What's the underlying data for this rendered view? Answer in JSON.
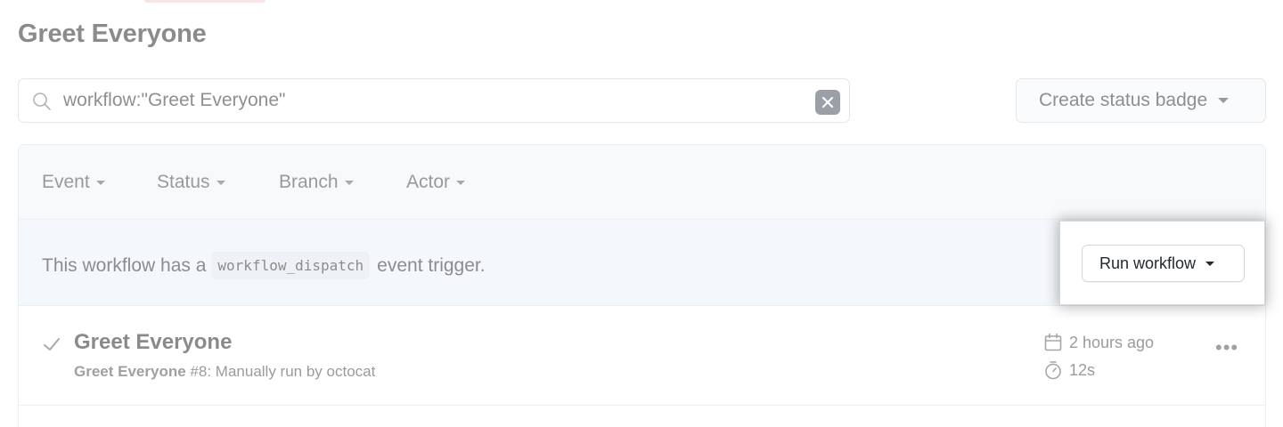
{
  "page": {
    "title": "Greet Everyone"
  },
  "search": {
    "query": "workflow:\"Greet Everyone\""
  },
  "actions": {
    "status_badge_label": "Create status badge"
  },
  "filters": [
    {
      "label": "Event"
    },
    {
      "label": "Status"
    },
    {
      "label": "Branch"
    },
    {
      "label": "Actor"
    }
  ],
  "dispatch": {
    "prefix": "This workflow has a",
    "code": "workflow_dispatch",
    "suffix": "event trigger.",
    "run_label": "Run workflow"
  },
  "runs": [
    {
      "title": "Greet Everyone",
      "workflow": "Greet Everyone",
      "number": "#8",
      "trigger_text": ": Manually run by",
      "actor": "octocat",
      "time_ago": "2 hours ago",
      "duration": "12s",
      "status_icon": "check-icon"
    }
  ]
}
